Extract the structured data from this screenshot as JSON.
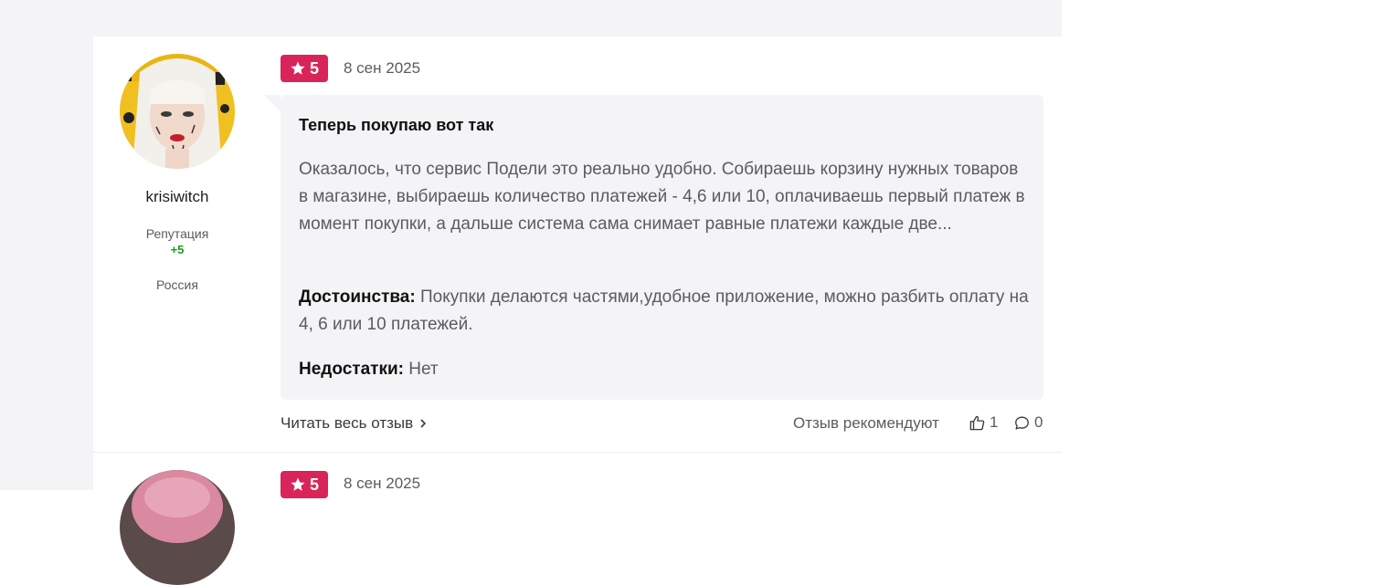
{
  "review1": {
    "rating": "5",
    "date": "8 сен 2025",
    "author": {
      "name": "krisiwitch",
      "reputation_label": "Репутация",
      "reputation_value": "+5",
      "country": "Россия"
    },
    "title": "Теперь покупаю вот так",
    "text": "Оказалось, что сервис Подели это реально удобно. Собираешь корзину нужных товаров в магазине, выбираешь количество платежей - 4,6 или 10, оплачиваешь первый платеж в момент покупки, а дальше система сама снимает равные платежи каждые две...",
    "pros_label": "Достоинства:",
    "pros_text": "Покупки делаются частями,удобное приложение, можно разбить оплату на 4, 6 или 10 платежей.",
    "cons_label": "Недостатки:",
    "cons_text": "Нет",
    "read_more": "Читать весь отзыв",
    "recommend_label": "Отзыв рекомендуют",
    "likes": "1",
    "comments": "0"
  },
  "review2": {
    "rating": "5",
    "date": "8 сен 2025"
  },
  "icons": {
    "star": "star-icon",
    "chevron": "chevron-right-icon",
    "thumb": "thumbs-up-icon",
    "comment": "comment-icon"
  },
  "colors": {
    "rating_badge": "#d9245a",
    "reputation": "#17a117",
    "bubble": "#f4f4f6"
  }
}
